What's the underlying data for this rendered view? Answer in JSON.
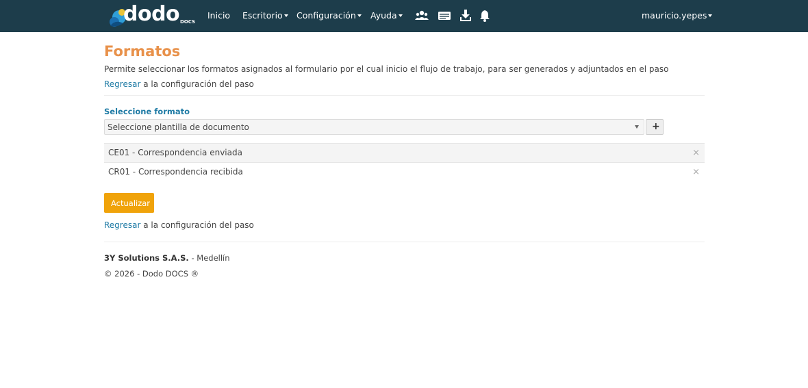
{
  "header": {
    "logo_text": "dodo",
    "logo_sub": "DOCS",
    "nav": {
      "inicio": "Inicio",
      "escritorio": "Escritorio",
      "configuracion": "Configuración",
      "ayuda": "Ayuda"
    },
    "icons": [
      "users-icon",
      "id-card-icon",
      "download-icon",
      "bell-icon"
    ],
    "user": "mauricio.yepes",
    "bg_color": "#1d3d4b"
  },
  "page": {
    "title": "Formatos",
    "title_color": "#e8914a",
    "description": "Permite seleccionar los formatos asignados al formulario por el cual inicio el flujo de trabajo, para ser generados y adjuntados en el paso",
    "back_link": "Regresar",
    "back_text": " a la configuración del paso"
  },
  "form": {
    "label": "Seleccione formato",
    "select_placeholder": "Seleccione plantilla de documento",
    "add_symbol": "+",
    "items": [
      {
        "label": "CE01 - Correspondencia enviada",
        "remove": "×"
      },
      {
        "label": "CR01 - Correspondencia recibida",
        "remove": "×"
      }
    ],
    "submit_label": "Actualizar",
    "submit_color": "#f0a30a"
  },
  "footer": {
    "company": "3Y Solutions S.A.S.",
    "location": " - Medellín",
    "copyright": "© 2026 - Dodo DOCS ®"
  }
}
